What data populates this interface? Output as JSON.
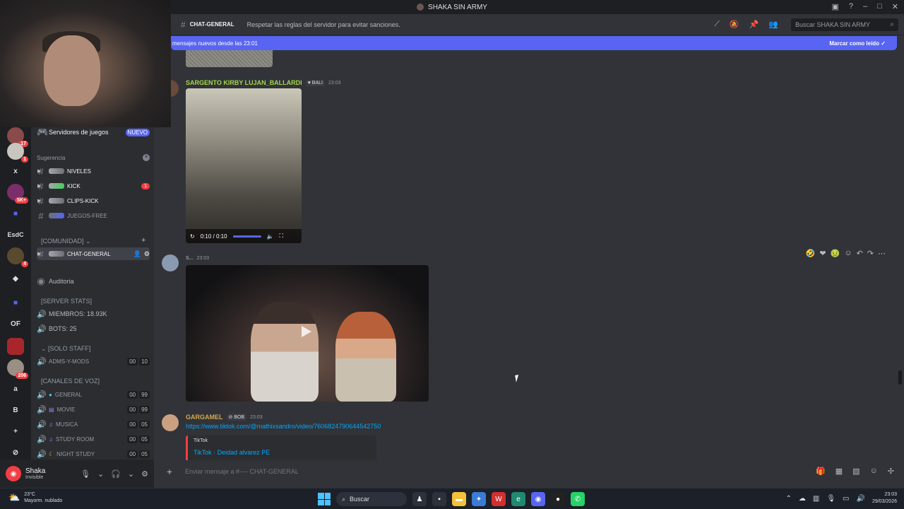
{
  "window": {
    "title": "SHAKA SIN ARMY"
  },
  "rail": {
    "badge_top": "17",
    "badge_1": "1",
    "srv_x": "x",
    "badge_5k": "5K+",
    "srv_esdc": "EsdC",
    "badge_4": "4",
    "srv_of": "OF",
    "badge_206": "206",
    "srv_a": "a",
    "srv_b": "B"
  },
  "sidebar": {
    "game_servers": "Servidores de juegos",
    "game_servers_badge": "NUEVO",
    "suggestion": "Sugerencia",
    "channels": [
      {
        "name": "NIVELES"
      },
      {
        "name": "KICK",
        "unread": "1"
      },
      {
        "name": "CLIPS-KICK"
      },
      {
        "name": "JUEGOS-FREE"
      }
    ],
    "category_comunidad": "[COMUNIDAD]",
    "active_channel": "CHAT-GENERAL",
    "auditoria": "Auditoria",
    "category_stats": "[SERVER STATS]",
    "stat_members": "MIEMBROS: 18.93K",
    "stat_bots": "BOTS: 25",
    "category_staff": "[SOLO STAFF]",
    "staff_channel": "ADMS-Y-MODS",
    "staff_c1": "00",
    "staff_c2": "10",
    "category_voice": "[CANALES DE VOZ]",
    "voice": [
      {
        "name": "GENERAL",
        "c1": "00",
        "c2": "99"
      },
      {
        "name": "MOVIE",
        "c1": "00",
        "c2": "99"
      },
      {
        "name": "MUSICA",
        "c1": "00",
        "c2": "05"
      },
      {
        "name": "STUDY ROOM",
        "c1": "00",
        "c2": "05"
      },
      {
        "name": "NIGHT STUDY",
        "c1": "00",
        "c2": "05"
      }
    ]
  },
  "user": {
    "name": "Shaka",
    "status": "Invisible"
  },
  "header": {
    "channel": "CHAT-GENERAL",
    "topic": "Respetar las reglas del servidor para evitar sanciones.",
    "search_placeholder": "Buscar SHAKA SIN ARMY"
  },
  "newbar": {
    "left": "mensajes nuevos desde las 23:01",
    "right": "Marcar como leído"
  },
  "messages": {
    "m1_author": "SARGENTO KIRBY LUJAN_BALLARDI",
    "m1_tag": "BALI",
    "m1_time": "23:03",
    "m1_video_time": "0:10 / 0:10",
    "m2_author": "S...",
    "m2_time": "23:03",
    "m3_author": "GARGAMEL",
    "m3_tag": "BOB",
    "m3_time": "23:03",
    "m3_link": "https://www.tiktok.com/@mathixsandro/video/7606824790644542750",
    "embed_provider": "TikTok",
    "embed_title": "TikTok · Deidad alvarez PE"
  },
  "composer": {
    "placeholder": "Enviar mensaje a #---- CHAT-GENERAL"
  },
  "taskbar": {
    "temp": "23°C",
    "weather": "Mayorm. nublado",
    "search": "Buscar",
    "time": "23:03",
    "date": "29/03/2026"
  },
  "colors": {
    "accent": "#5865f2",
    "author1": "#a3d54a",
    "author3": "#d4a94a",
    "danger": "#f23f43",
    "link": "#00a8fc"
  }
}
